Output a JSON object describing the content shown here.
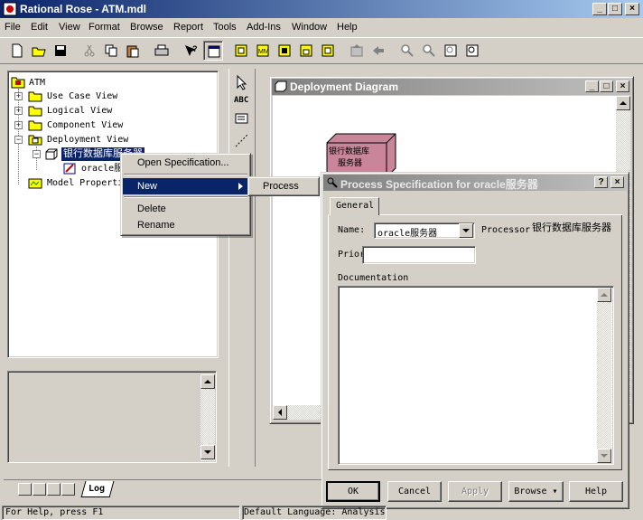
{
  "window": {
    "title": "Rational Rose - ATM.mdl"
  },
  "menu": [
    "File",
    "Edit",
    "View",
    "Format",
    "Browse",
    "Report",
    "Tools",
    "Add-Ins",
    "Window",
    "Help"
  ],
  "palette": {
    "text_tool": "ABC"
  },
  "tree": {
    "root": "ATM",
    "items": [
      "Use Case View",
      "Logical View",
      "Component View",
      "Deployment View"
    ],
    "processor": "银行数据库服务器",
    "child_node": "oracle服务器",
    "child_visible": "oracle服",
    "model_properties": "Model Properties"
  },
  "context_menu": {
    "items": [
      "Open Specification...",
      "New",
      "Delete",
      "Rename"
    ],
    "submenu": [
      "Process"
    ]
  },
  "deployment": {
    "title": "Deployment Diagram",
    "node_label": "银行数据库服务器",
    "node_line1": "银行数据库",
    "node_line2": "服务器"
  },
  "dialog": {
    "title": "Process Specification for oracle服务器",
    "tab": "General",
    "name_label": "Name:",
    "name_value": "oracle服务器",
    "processor_label": "Processor",
    "processor_value": "银行数据库服务器",
    "priority_label": "Priority",
    "priority_visible": "Priorit",
    "priority_value": "",
    "documentation_label": "Documentation",
    "documentation_value": "",
    "buttons": [
      "OK",
      "Cancel",
      "Apply",
      "Browse ▾",
      "Help"
    ]
  },
  "log_tab": "Log",
  "status": {
    "help": "For Help, press F1",
    "language": "Default Language: Analysis"
  },
  "colors": {
    "title_active": "#0a246a",
    "title_inactive": "#808080",
    "node_fill": "#c9859a",
    "selection": "#0a246a"
  }
}
